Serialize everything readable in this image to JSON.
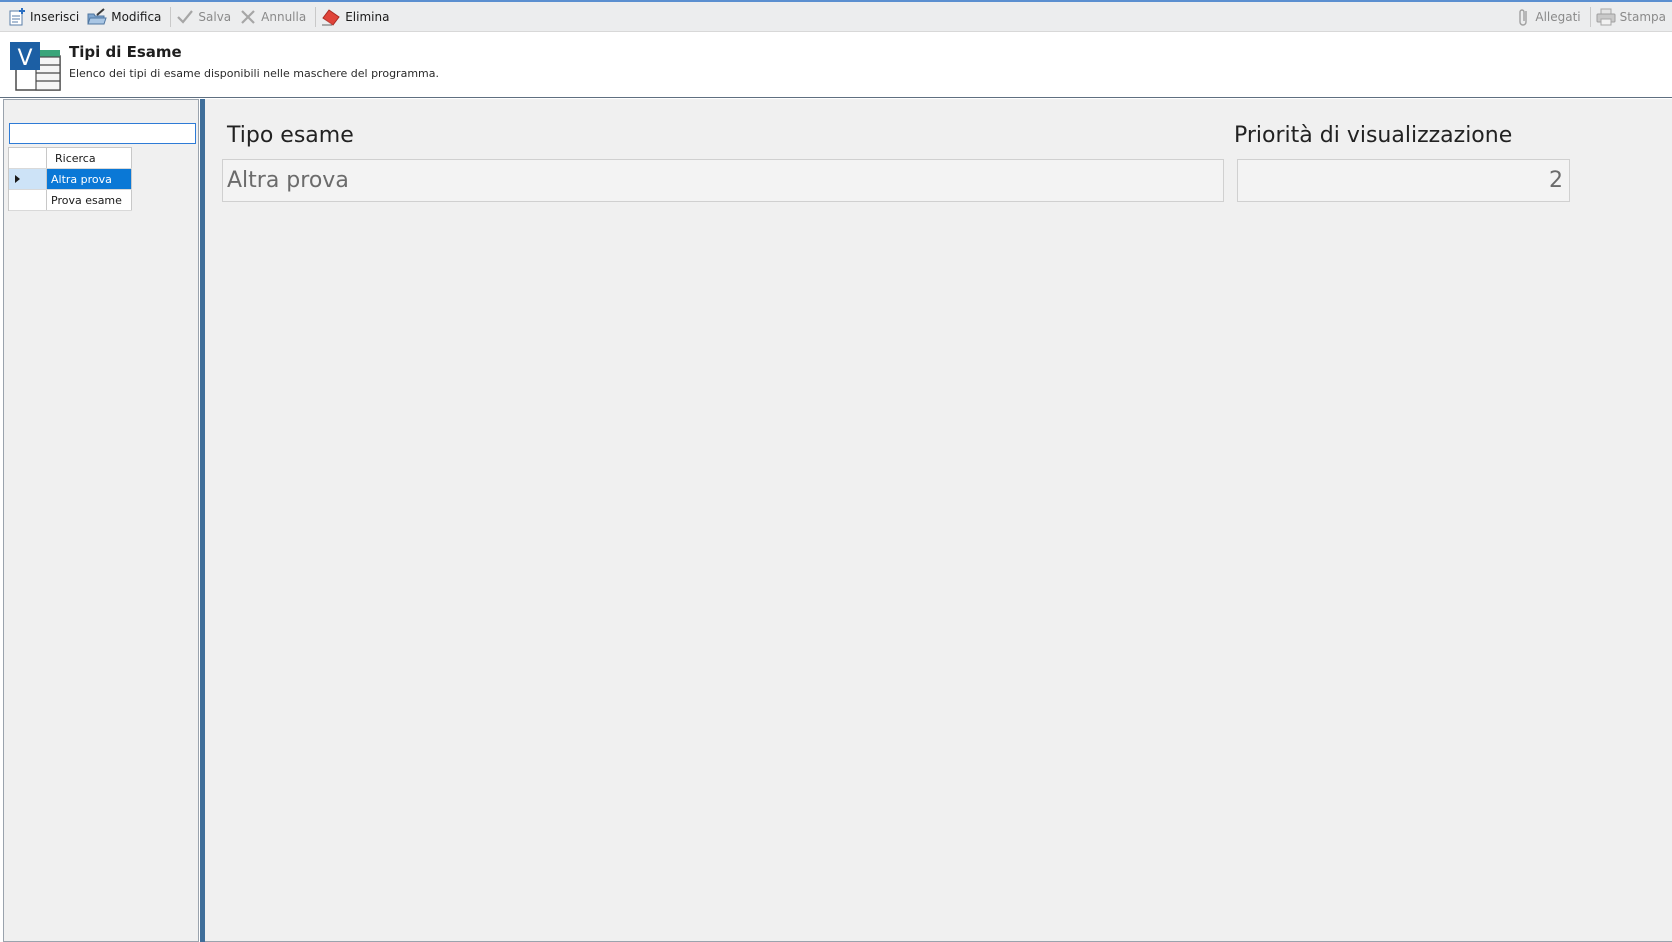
{
  "toolbar": {
    "left": [
      {
        "label": "Inserisci",
        "icon": "insert-icon",
        "enabled": true
      },
      {
        "label": "Modifica",
        "icon": "edit-folder-icon",
        "enabled": true
      },
      {
        "label": "Salva",
        "icon": "check-icon",
        "enabled": false
      },
      {
        "label": "Annulla",
        "icon": "x-icon",
        "enabled": false
      },
      {
        "label": "Elimina",
        "icon": "eraser-icon",
        "enabled": true
      }
    ],
    "right": [
      {
        "label": "Allegati",
        "icon": "paperclip-icon",
        "enabled": false
      },
      {
        "label": "Stampa",
        "icon": "printer-icon",
        "enabled": false
      }
    ]
  },
  "header": {
    "title": "Tipi di Esame",
    "subtitle": "Elenco dei tipi di esame disponibili nelle maschere del programma.",
    "logo_letter": "V"
  },
  "left_panel": {
    "search": {
      "value": "",
      "placeholder": ""
    },
    "grid_header": "Ricerca",
    "rows": [
      {
        "label": "Altra prova",
        "selected": true
      },
      {
        "label": "Prova esame",
        "selected": false
      }
    ]
  },
  "form": {
    "tipo_label": "Tipo esame",
    "tipo_value": "Altra prova",
    "priorita_label": "Priorità di visualizzazione",
    "priorita_value": "2"
  },
  "colors": {
    "accent": "#0a78d6",
    "splitter": "#3f6e9a",
    "logo_blue": "#1c5fa4",
    "logo_green": "#3aa57a",
    "eraser": "#e0443a"
  }
}
